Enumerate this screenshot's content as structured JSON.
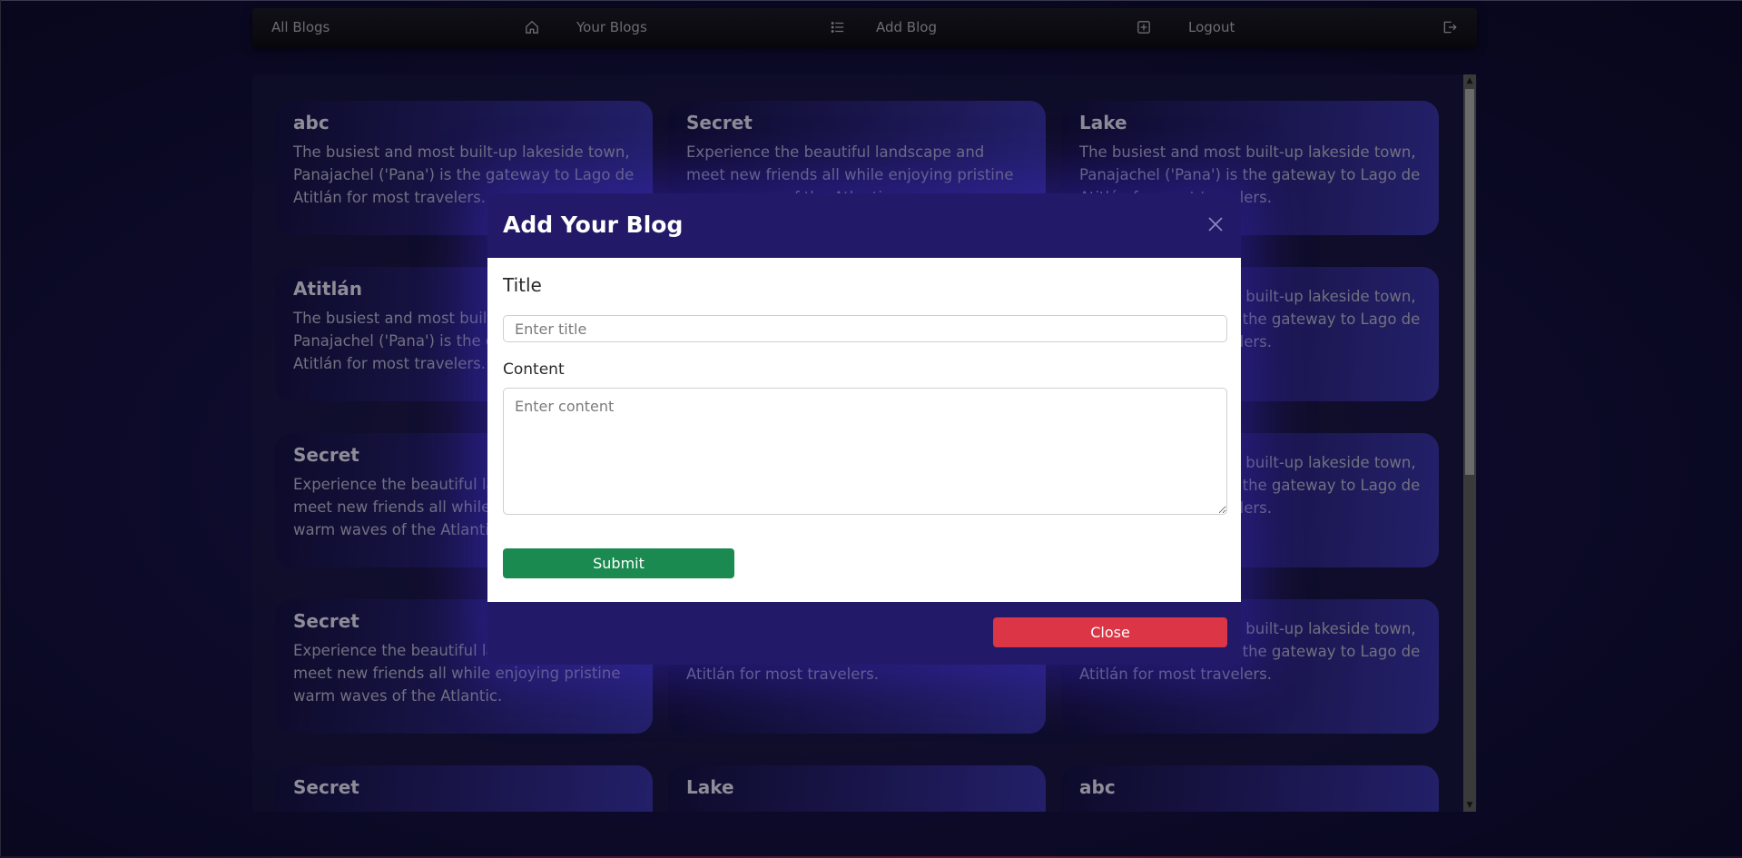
{
  "navbar": {
    "items": [
      {
        "label": "All Blogs",
        "icon": "home-icon"
      },
      {
        "label": "Your Blogs",
        "icon": "list-icon"
      },
      {
        "label": "Add Blog",
        "icon": "plus-square-icon"
      },
      {
        "label": "Logout",
        "icon": "logout-icon"
      }
    ]
  },
  "cards": [
    {
      "title": "abc",
      "body": "The busiest and most built-up lakeside town, Panajachel ('Pana') is the gateway to Lago de Atitlán for most travelers."
    },
    {
      "title": "Secret",
      "body": "Experience the beautiful landscape and meet new friends all while enjoying pristine warm waves of the Atlantic."
    },
    {
      "title": "Lake",
      "body": "The busiest and most built-up lakeside town, Panajachel ('Pana') is the gateway to Lago de Atitlán for most travelers."
    },
    {
      "title": "Atitlán",
      "body": "The busiest and most built-up lakeside town, Panajachel ('Pana') is the gateway to Lago de Atitlán for most travelers."
    },
    {
      "title": "",
      "body": ""
    },
    {
      "title": "",
      "body": "The busiest and most built-up lakeside town, Panajachel ('Pana') is the gateway to Lago de Atitlán for most travelers."
    },
    {
      "title": "Secret",
      "body": "Experience the beautiful landscape and meet new friends all while enjoying pristine warm waves of the Atlantic."
    },
    {
      "title": "",
      "body": ""
    },
    {
      "title": "",
      "body": "The busiest and most built-up lakeside town, Panajachel ('Pana') is the gateway to Lago de Atitlán for most travelers."
    },
    {
      "title": "Secret",
      "body": "Experience the beautiful landscape and meet new friends all while enjoying pristine warm waves of the Atlantic."
    },
    {
      "title": "",
      "body": "The busiest and most built-up lakeside town, Panajachel ('Pana') is the gateway to Lago de Atitlán for most travelers."
    },
    {
      "title": "",
      "body": "The busiest and most built-up lakeside town, Panajachel ('Pana') is the gateway to Lago de Atitlán for most travelers."
    },
    {
      "title": "Secret",
      "body": ""
    },
    {
      "title": "Lake",
      "body": ""
    },
    {
      "title": "abc",
      "body": ""
    }
  ],
  "modal": {
    "title": "Add Your Blog",
    "title_label": "Title",
    "title_placeholder": "Enter title",
    "content_label": "Content",
    "content_placeholder": "Enter content",
    "submit_label": "Submit",
    "close_label": "Close"
  },
  "colors": {
    "modal_header": "#221a68",
    "submit": "#1b8a50",
    "close": "#dc3545"
  }
}
